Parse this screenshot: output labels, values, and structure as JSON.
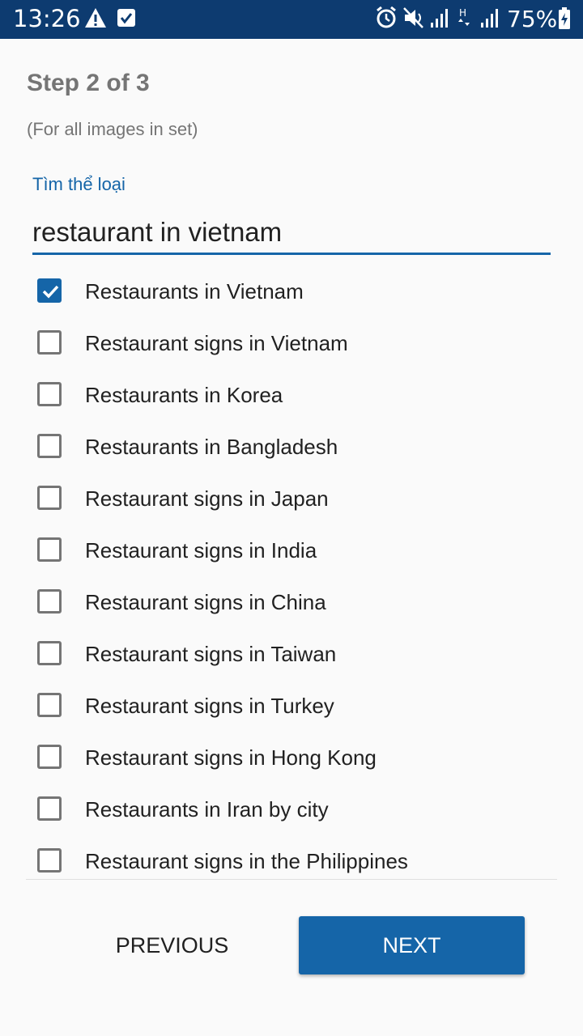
{
  "status_bar": {
    "time": "13:26",
    "battery": "75%",
    "icons": [
      "warning-icon",
      "checkbox-notification-icon",
      "alarm-icon",
      "mute-icon",
      "signal-icon",
      "data-h-icon",
      "signal-icon",
      "battery-charging-icon"
    ]
  },
  "header": {
    "step": "Step 2 of 3",
    "subtitle": "(For all images in set)"
  },
  "search": {
    "label": "Tìm thể loại",
    "value": "restaurant in vietnam"
  },
  "categories": [
    {
      "label": "Restaurants in Vietnam",
      "checked": true
    },
    {
      "label": "Restaurant signs in Vietnam",
      "checked": false
    },
    {
      "label": "Restaurants in Korea",
      "checked": false
    },
    {
      "label": "Restaurants in Bangladesh",
      "checked": false
    },
    {
      "label": "Restaurant signs in Japan",
      "checked": false
    },
    {
      "label": "Restaurant signs in India",
      "checked": false
    },
    {
      "label": "Restaurant signs in China",
      "checked": false
    },
    {
      "label": "Restaurant signs in Taiwan",
      "checked": false
    },
    {
      "label": "Restaurant signs in Turkey",
      "checked": false
    },
    {
      "label": "Restaurant signs in Hong Kong",
      "checked": false
    },
    {
      "label": "Restaurants in Iran by city",
      "checked": false
    },
    {
      "label": "Restaurant signs in the Philippines",
      "checked": false
    }
  ],
  "buttons": {
    "previous": "PREVIOUS",
    "next": "NEXT"
  },
  "colors": {
    "accent": "#1565a8",
    "status_bar": "#0d3b70"
  }
}
